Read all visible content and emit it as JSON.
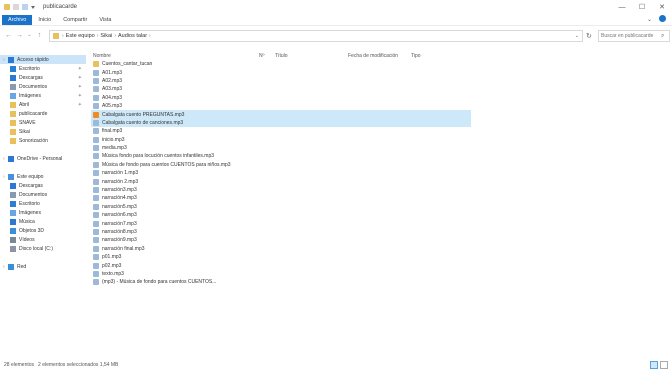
{
  "window": {
    "title": "publicacarde"
  },
  "ribbon": {
    "tabs": [
      "Archivo",
      "Inicio",
      "Compartir",
      "Vista"
    ]
  },
  "address": {
    "crumbs": [
      "Este equipo",
      "Sikai",
      "Audios talar"
    ],
    "search_placeholder": "Buscar en publicacarde"
  },
  "sidebar": {
    "items": [
      {
        "label": "Acceso rápido",
        "icon": "star-icon",
        "color": "#2b79d4",
        "selected": true,
        "pinned": false,
        "level": 0
      },
      {
        "label": "Escritorio",
        "icon": "desktop-icon",
        "color": "#2a7ed6",
        "pinned": true,
        "level": 1
      },
      {
        "label": "Descargas",
        "icon": "download-icon",
        "color": "#2b79d4",
        "pinned": true,
        "level": 1
      },
      {
        "label": "Documentos",
        "icon": "document-icon",
        "color": "#8a9bb0",
        "pinned": true,
        "level": 1
      },
      {
        "label": "Imágenes",
        "icon": "picture-icon",
        "color": "#6aa6e0",
        "pinned": true,
        "level": 1
      },
      {
        "label": "Abril",
        "icon": "folder-icon",
        "color": "#e8c15c",
        "pinned": true,
        "level": 1
      },
      {
        "label": "publicacarde",
        "icon": "folder-icon",
        "color": "#e8c15c",
        "pinned": false,
        "level": 1
      },
      {
        "label": "SNAVE",
        "icon": "folder-icon",
        "color": "#e8c15c",
        "pinned": false,
        "level": 1
      },
      {
        "label": "Sikai",
        "icon": "folder-icon",
        "color": "#e8c15c",
        "pinned": false,
        "level": 1
      },
      {
        "label": "Sonorización",
        "icon": "folder-icon",
        "color": "#e8c15c",
        "pinned": false,
        "level": 1
      },
      {
        "label": "",
        "icon": "",
        "color": "",
        "pinned": false,
        "level": 0
      },
      {
        "label": "OneDrive - Personal",
        "icon": "cloud-icon",
        "color": "#2b79d4",
        "pinned": false,
        "level": 0
      },
      {
        "label": "",
        "icon": "",
        "color": "",
        "pinned": false,
        "level": 0
      },
      {
        "label": "Este equipo",
        "icon": "computer-icon",
        "color": "#4a90d9",
        "pinned": false,
        "level": 0
      },
      {
        "label": "Descargas",
        "icon": "download-icon",
        "color": "#2b79d4",
        "pinned": false,
        "level": 1
      },
      {
        "label": "Documentos",
        "icon": "document-icon",
        "color": "#8a9bb0",
        "pinned": false,
        "level": 1
      },
      {
        "label": "Escritorio",
        "icon": "desktop-icon",
        "color": "#2a7ed6",
        "pinned": false,
        "level": 1
      },
      {
        "label": "Imágenes",
        "icon": "picture-icon",
        "color": "#6aa6e0",
        "pinned": false,
        "level": 1
      },
      {
        "label": "Música",
        "icon": "music-icon",
        "color": "#2b79d4",
        "pinned": false,
        "level": 1
      },
      {
        "label": "Objetos 3D",
        "icon": "cube-icon",
        "color": "#3a8fd8",
        "pinned": false,
        "level": 1
      },
      {
        "label": "Vídeos",
        "icon": "video-icon",
        "color": "#7a8796",
        "pinned": false,
        "level": 1
      },
      {
        "label": "Disco local (C:)",
        "icon": "drive-icon",
        "color": "#8b95a3",
        "pinned": false,
        "level": 1
      },
      {
        "label": "",
        "icon": "",
        "color": "",
        "pinned": false,
        "level": 0
      },
      {
        "label": "Red",
        "icon": "network-icon",
        "color": "#3a8fd8",
        "pinned": false,
        "level": 0
      }
    ]
  },
  "columns": {
    "name": "Nombre",
    "num": "Nº",
    "title": "Título",
    "date": "Fecha de modificación",
    "type": "Tipo"
  },
  "files": [
    {
      "name": "Cuentos_cantar_tucan",
      "type": "folder",
      "selected": false
    },
    {
      "name": "A01.mp3",
      "type": "audio",
      "selected": false
    },
    {
      "name": "A02.mp3",
      "type": "audio",
      "selected": false
    },
    {
      "name": "A03.mp3",
      "type": "audio",
      "selected": false
    },
    {
      "name": "A04.mp3",
      "type": "audio",
      "selected": false
    },
    {
      "name": "A05.mp3",
      "type": "audio",
      "selected": false
    },
    {
      "name": "Cabalgata cuento PREGUNTAS.mp3",
      "type": "audio-vlc",
      "selected": true
    },
    {
      "name": "Cabalgata cuento de canciones.mp3",
      "type": "audio",
      "selected": true
    },
    {
      "name": "final.mp3",
      "type": "audio",
      "selected": false
    },
    {
      "name": "inicio.mp3",
      "type": "audio",
      "selected": false
    },
    {
      "name": "media.mp3",
      "type": "audio",
      "selected": false
    },
    {
      "name": "Música fondo para locución cuentos infantiles.mp3",
      "type": "audio",
      "selected": false
    },
    {
      "name": "Música de fondo para cuentos CUENTOS para niños.mp3",
      "type": "audio",
      "selected": false
    },
    {
      "name": "narración 1.mp3",
      "type": "audio",
      "selected": false
    },
    {
      "name": "narración 2.mp3",
      "type": "audio",
      "selected": false
    },
    {
      "name": "narración3.mp3",
      "type": "audio",
      "selected": false
    },
    {
      "name": "narración4.mp3",
      "type": "audio",
      "selected": false
    },
    {
      "name": "narración5.mp3",
      "type": "audio",
      "selected": false
    },
    {
      "name": "narración6.mp3",
      "type": "audio",
      "selected": false
    },
    {
      "name": "narración7.mp3",
      "type": "audio",
      "selected": false
    },
    {
      "name": "narración8.mp3",
      "type": "audio",
      "selected": false
    },
    {
      "name": "narración9.mp3",
      "type": "audio",
      "selected": false
    },
    {
      "name": "narración final.mp3",
      "type": "audio",
      "selected": false
    },
    {
      "name": "p01.mp3",
      "type": "audio",
      "selected": false
    },
    {
      "name": "p02.mp3",
      "type": "audio",
      "selected": false
    },
    {
      "name": "texto.mp3",
      "type": "audio",
      "selected": false
    },
    {
      "name": "(mp3) - Música de fondo para cuentos CUENTOS...",
      "type": "audio",
      "selected": false
    }
  ],
  "status": {
    "count": "28 elementos",
    "selection": "2 elementos seleccionados 1,54 MB"
  },
  "colors": {
    "accent": "#1a73c8",
    "selection": "#cde8f8",
    "folder": "#e8c15c"
  }
}
